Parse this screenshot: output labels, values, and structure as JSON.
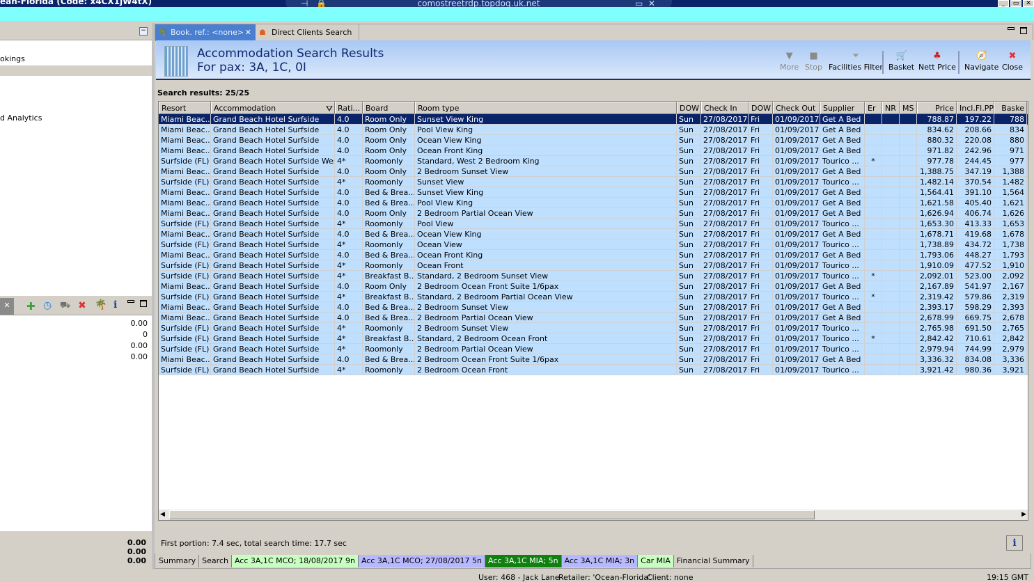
{
  "window": {
    "title": "ean-Florida (Code: x4CX1jW4tX)",
    "rdp_host": "comostreetrdp.topdog.uk.net"
  },
  "left": {
    "items": [
      "okings",
      "d Analytics"
    ],
    "values": [
      "0.00",
      "0",
      "0.00",
      "0.00"
    ],
    "totals": [
      "0.00",
      "0.00",
      "0.00"
    ]
  },
  "tabs": [
    {
      "label": "Book. ref.: <none>",
      "icon": "palm-tree-icon"
    },
    {
      "label": "Direct Clients Search",
      "icon": "client-icon"
    }
  ],
  "banner": {
    "title": "Accommodation Search Results",
    "subtitle": "For pax: 3A, 1C, 0I"
  },
  "toolbar": [
    {
      "label": "More",
      "icon": "triangle-down-icon",
      "enabled": false
    },
    {
      "label": "Stop",
      "icon": "stop-icon",
      "enabled": false
    },
    {
      "label": "Facilities Filter",
      "icon": "funnel-icon",
      "enabled": true
    },
    {
      "label": "Basket",
      "icon": "cart-icon",
      "enabled": true
    },
    {
      "label": "Nett Price",
      "icon": "nett-price-icon",
      "enabled": true
    },
    {
      "label": "Navigate",
      "icon": "compass-icon",
      "enabled": true
    },
    {
      "label": "Close",
      "icon": "close-icon",
      "enabled": true
    }
  ],
  "results_label": "Search results: 25/25",
  "columns": [
    "Resort",
    "Accommodation",
    "Rati...",
    "Board",
    "Room type",
    "DOW",
    "Check In",
    "DOW",
    "Check Out",
    "Supplier",
    "Er",
    "NR",
    "MS",
    "Price",
    "Incl.Fl.PP",
    "Baske"
  ],
  "rows": [
    [
      "Miami Beac...",
      "Grand Beach Hotel Surfside",
      "4.0",
      "Room Only",
      "Sunset View King",
      "Sun",
      "27/08/2017",
      "Fri",
      "01/09/2017",
      "Get A Bed",
      "",
      "",
      "",
      "788.87",
      "197.22",
      "788"
    ],
    [
      "Miami Beac...",
      "Grand Beach Hotel Surfside",
      "4.0",
      "Room Only",
      "Pool View King",
      "Sun",
      "27/08/2017",
      "Fri",
      "01/09/2017",
      "Get A Bed",
      "",
      "",
      "",
      "834.62",
      "208.66",
      "834"
    ],
    [
      "Miami Beac...",
      "Grand Beach Hotel Surfside",
      "4.0",
      "Room Only",
      "Ocean View King",
      "Sun",
      "27/08/2017",
      "Fri",
      "01/09/2017",
      "Get A Bed",
      "",
      "",
      "",
      "880.32",
      "220.08",
      "880"
    ],
    [
      "Miami Beac...",
      "Grand Beach Hotel Surfside",
      "4.0",
      "Room Only",
      "Ocean Front King",
      "Sun",
      "27/08/2017",
      "Fri",
      "01/09/2017",
      "Get A Bed",
      "",
      "",
      "",
      "971.82",
      "242.96",
      "971"
    ],
    [
      "Surfside (FL)",
      "Grand Beach Hotel Surfside West",
      "4*",
      "Roomonly",
      "Standard, West 2 Bedroom King",
      "Sun",
      "27/08/2017",
      "Fri",
      "01/09/2017",
      "Tourico ...",
      "*",
      "",
      "",
      "977.78",
      "244.45",
      "977"
    ],
    [
      "Miami Beac...",
      "Grand Beach Hotel Surfside",
      "4.0",
      "Room Only",
      "2 Bedroom Sunset View",
      "Sun",
      "27/08/2017",
      "Fri",
      "01/09/2017",
      "Get A Bed",
      "",
      "",
      "",
      "1,388.75",
      "347.19",
      "1,388"
    ],
    [
      "Surfside (FL)",
      "Grand Beach Hotel Surfside",
      "4*",
      "Roomonly",
      "Sunset View",
      "Sun",
      "27/08/2017",
      "Fri",
      "01/09/2017",
      "Tourico ...",
      "",
      "",
      "",
      "1,482.14",
      "370.54",
      "1,482"
    ],
    [
      "Miami Beac...",
      "Grand Beach Hotel Surfside",
      "4.0",
      "Bed & Brea...",
      "Sunset View King",
      "Sun",
      "27/08/2017",
      "Fri",
      "01/09/2017",
      "Get A Bed",
      "",
      "",
      "",
      "1,564.41",
      "391.10",
      "1,564"
    ],
    [
      "Miami Beac...",
      "Grand Beach Hotel Surfside",
      "4.0",
      "Bed & Brea...",
      "Pool View King",
      "Sun",
      "27/08/2017",
      "Fri",
      "01/09/2017",
      "Get A Bed",
      "",
      "",
      "",
      "1,621.58",
      "405.40",
      "1,621"
    ],
    [
      "Miami Beac...",
      "Grand Beach Hotel Surfside",
      "4.0",
      "Room Only",
      "2 Bedroom Partial Ocean View",
      "Sun",
      "27/08/2017",
      "Fri",
      "01/09/2017",
      "Get A Bed",
      "",
      "",
      "",
      "1,626.94",
      "406.74",
      "1,626"
    ],
    [
      "Surfside (FL)",
      "Grand Beach Hotel Surfside",
      "4*",
      "Roomonly",
      "Pool View",
      "Sun",
      "27/08/2017",
      "Fri",
      "01/09/2017",
      "Tourico ...",
      "",
      "",
      "",
      "1,653.30",
      "413.33",
      "1,653"
    ],
    [
      "Miami Beac...",
      "Grand Beach Hotel Surfside",
      "4.0",
      "Bed & Brea...",
      "Ocean View King",
      "Sun",
      "27/08/2017",
      "Fri",
      "01/09/2017",
      "Get A Bed",
      "",
      "",
      "",
      "1,678.71",
      "419.68",
      "1,678"
    ],
    [
      "Surfside (FL)",
      "Grand Beach Hotel Surfside",
      "4*",
      "Roomonly",
      "Ocean View",
      "Sun",
      "27/08/2017",
      "Fri",
      "01/09/2017",
      "Tourico ...",
      "",
      "",
      "",
      "1,738.89",
      "434.72",
      "1,738"
    ],
    [
      "Miami Beac...",
      "Grand Beach Hotel Surfside",
      "4.0",
      "Bed & Brea...",
      "Ocean Front King",
      "Sun",
      "27/08/2017",
      "Fri",
      "01/09/2017",
      "Get A Bed",
      "",
      "",
      "",
      "1,793.06",
      "448.27",
      "1,793"
    ],
    [
      "Surfside (FL)",
      "Grand Beach Hotel Surfside",
      "4*",
      "Roomonly",
      "Ocean Front",
      "Sun",
      "27/08/2017",
      "Fri",
      "01/09/2017",
      "Tourico ...",
      "",
      "",
      "",
      "1,910.09",
      "477.52",
      "1,910"
    ],
    [
      "Surfside (FL)",
      "Grand Beach Hotel Surfside",
      "4*",
      "Breakfast B...",
      "Standard, 2 Bedroom Sunset View",
      "Sun",
      "27/08/2017",
      "Fri",
      "01/09/2017",
      "Tourico ...",
      "*",
      "",
      "",
      "2,092.01",
      "523.00",
      "2,092"
    ],
    [
      "Miami Beac...",
      "Grand Beach Hotel Surfside",
      "4.0",
      "Room Only",
      "2 Bedroom Ocean Front Suite 1/6pax",
      "Sun",
      "27/08/2017",
      "Fri",
      "01/09/2017",
      "Get A Bed",
      "",
      "",
      "",
      "2,167.89",
      "541.97",
      "2,167"
    ],
    [
      "Surfside (FL)",
      "Grand Beach Hotel Surfside",
      "4*",
      "Breakfast B...",
      "Standard, 2 Bedroom Partial Ocean View",
      "Sun",
      "27/08/2017",
      "Fri",
      "01/09/2017",
      "Tourico ...",
      "*",
      "",
      "",
      "2,319.42",
      "579.86",
      "2,319"
    ],
    [
      "Miami Beac...",
      "Grand Beach Hotel Surfside",
      "4.0",
      "Bed & Brea...",
      "2 Bedroom Sunset View",
      "Sun",
      "27/08/2017",
      "Fri",
      "01/09/2017",
      "Get A Bed",
      "",
      "",
      "",
      "2,393.17",
      "598.29",
      "2,393"
    ],
    [
      "Miami Beac...",
      "Grand Beach Hotel Surfside",
      "4.0",
      "Bed & Brea...",
      "2 Bedroom Partial Ocean View",
      "Sun",
      "27/08/2017",
      "Fri",
      "01/09/2017",
      "Get A Bed",
      "",
      "",
      "",
      "2,678.99",
      "669.75",
      "2,678"
    ],
    [
      "Surfside (FL)",
      "Grand Beach Hotel Surfside",
      "4*",
      "Roomonly",
      "2 Bedroom Sunset View",
      "Sun",
      "27/08/2017",
      "Fri",
      "01/09/2017",
      "Tourico ...",
      "",
      "",
      "",
      "2,765.98",
      "691.50",
      "2,765"
    ],
    [
      "Surfside (FL)",
      "Grand Beach Hotel Surfside",
      "4*",
      "Breakfast B...",
      "Standard, 2 Bedroom Ocean Front",
      "Sun",
      "27/08/2017",
      "Fri",
      "01/09/2017",
      "Tourico ...",
      "*",
      "",
      "",
      "2,842.42",
      "710.61",
      "2,842"
    ],
    [
      "Surfside (FL)",
      "Grand Beach Hotel Surfside",
      "4*",
      "Roomonly",
      "2 Bedroom Partial Ocean View",
      "Sun",
      "27/08/2017",
      "Fri",
      "01/09/2017",
      "Tourico ...",
      "",
      "",
      "",
      "2,979.94",
      "744.99",
      "2,979"
    ],
    [
      "Miami Beac...",
      "Grand Beach Hotel Surfside",
      "4.0",
      "Bed & Brea...",
      "2 Bedroom Ocean Front Suite 1/6pax",
      "Sun",
      "27/08/2017",
      "Fri",
      "01/09/2017",
      "Get A Bed",
      "",
      "",
      "",
      "3,336.32",
      "834.08",
      "3,336"
    ],
    [
      "Surfside (FL)",
      "Grand Beach Hotel Surfside",
      "4*",
      "Roomonly",
      "2 Bedroom Ocean Front",
      "Sun",
      "27/08/2017",
      "Fri",
      "01/09/2017",
      "Tourico ...",
      "",
      "",
      "",
      "3,921.42",
      "980.36",
      "3,921"
    ]
  ],
  "status_line": "First portion: 7.4 sec, total search time: 17.7 sec",
  "bottom_tabs": [
    {
      "label": "Summary",
      "color": "#d4d0c8"
    },
    {
      "label": "Search",
      "color": "#d4d0c8"
    },
    {
      "label": "Acc 3A,1C MCO; 18/08/2017 9n",
      "color": "#c8ffc0"
    },
    {
      "label": "Acc 3A,1C MCO; 27/08/2017 5n",
      "color": "#b8b8ff"
    },
    {
      "label": "Acc 3A,1C MIA; 5n",
      "color": "#108010"
    },
    {
      "label": "Acc 3A,1C MIA; 3n",
      "color": "#b8b8ff"
    },
    {
      "label": "Car MIA",
      "color": "#c8ffc0"
    },
    {
      "label": "Financial Summary",
      "color": "#d4d0c8"
    }
  ],
  "statusbar": {
    "user": "User: 468 - Jack Lane",
    "retailer": "Retailer: 'Ocean-Florida'",
    "client": "Client: none",
    "time": "19:15 GMT"
  }
}
